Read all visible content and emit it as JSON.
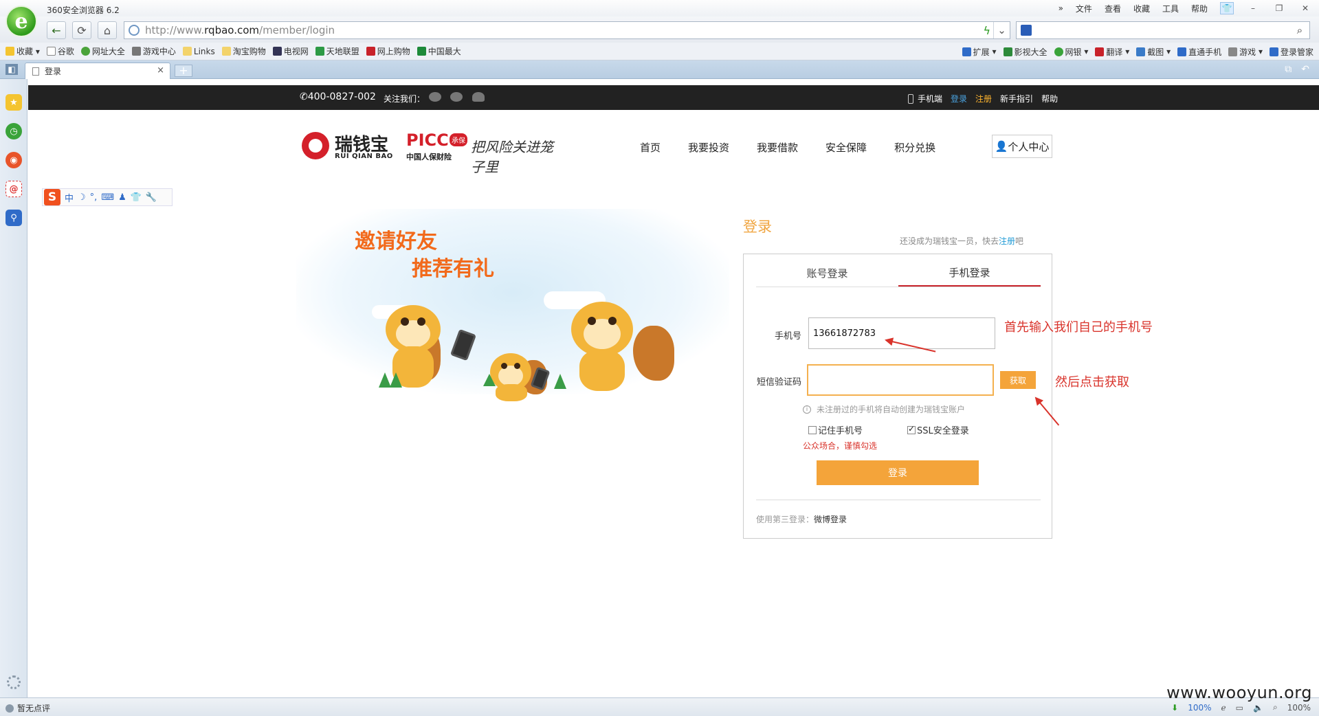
{
  "browser": {
    "app_title": "360安全浏览器 6.2",
    "menu": [
      "文件",
      "查看",
      "收藏",
      "工具",
      "帮助"
    ],
    "url_prefix": "http://www.",
    "url_host": "rqbao.com",
    "url_path": "/member/login",
    "bookmarks": [
      "收藏",
      "谷歌",
      "网址大全",
      "游戏中心",
      "Links",
      "淘宝购物",
      "电视网",
      "天地联盟",
      "网上购物",
      "中国最大"
    ],
    "toolbar_right": [
      "扩展",
      "影视大全",
      "网银",
      "翻译",
      "截图",
      "直通手机",
      "游戏",
      "登录管家"
    ],
    "tab_title": "登录",
    "status_text": "暂无点评",
    "zoom_a": "100%",
    "zoom_b": "100%"
  },
  "site": {
    "hotline": "400-0827-002",
    "follow": "关注我们：",
    "top_links": {
      "mobile": "手机端",
      "login": "登录",
      "register": "注册",
      "guide": "新手指引",
      "help": "帮助"
    },
    "brand_zh": "瑞钱宝",
    "brand_en": "RUI QIAN BAO",
    "partner": "PICC",
    "partner_badge": "承保",
    "partner_sub": "中国人保财险",
    "slogan": "把风险关进笼子里",
    "nav": [
      "首页",
      "我要投资",
      "我要借款",
      "安全保障",
      "积分兑换"
    ],
    "user_center": "个人中心"
  },
  "banner": {
    "line1": "邀请好友",
    "line2": "推荐有礼"
  },
  "login": {
    "title": "登录",
    "reg_hint_pre": "还没成为瑞钱宝一员，快去",
    "reg_link": "注册",
    "reg_hint_post": "吧",
    "tab_account": "账号登录",
    "tab_mobile": "手机登录",
    "phone_label": "手机号",
    "phone_value": "13661872783",
    "code_label": "短信验证码",
    "code_value": "",
    "get_code": "获取",
    "note": "未注册过的手机将自动创建为瑞钱宝账户",
    "remember": "记住手机号",
    "ssl": "SSL安全登录",
    "warning": "公众场合，谨慎勾选",
    "submit": "登录",
    "third_pre": "使用第三登录：",
    "third_link": "微博登录"
  },
  "annotations": {
    "a1": "首先输入我们自己的手机号",
    "a2": "然后点击获取",
    "watermark": "www.wooyun.org"
  },
  "colors": {
    "accent_orange": "#f4a43a",
    "brand_red": "#d4202a",
    "annotation_red": "#d9332b"
  }
}
